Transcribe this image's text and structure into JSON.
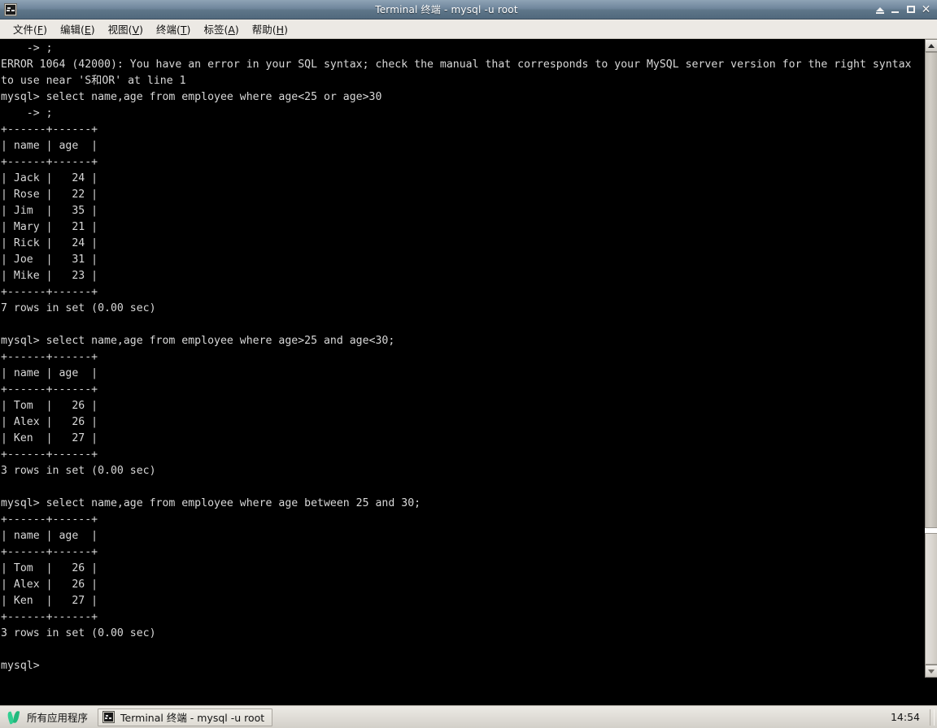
{
  "window": {
    "title": "Terminal 终端 - mysql -u root",
    "app_icon": "terminal-icon",
    "buttons": [
      {
        "name": "shade-button",
        "icon": "shade-icon"
      },
      {
        "name": "minimize-button",
        "icon": "minimize-icon"
      },
      {
        "name": "maximize-button",
        "icon": "maximize-icon"
      },
      {
        "name": "close-button",
        "icon": "close-icon",
        "label": "✕"
      }
    ]
  },
  "menubar": {
    "items": [
      {
        "label": "文件(F)",
        "text": "文件(",
        "key": "F",
        "tail": ")"
      },
      {
        "label": "编辑(E)",
        "text": "编辑(",
        "key": "E",
        "tail": ")"
      },
      {
        "label": "视图(V)",
        "text": "视图(",
        "key": "V",
        "tail": ")"
      },
      {
        "label": "终端(T)",
        "text": "终端(",
        "key": "T",
        "tail": ")"
      },
      {
        "label": "标签(A)",
        "text": "标签(",
        "key": "A",
        "tail": ")"
      },
      {
        "label": "帮助(H)",
        "text": "帮助(",
        "key": "H",
        "tail": ")"
      }
    ]
  },
  "terminal": {
    "background": "#000000",
    "foreground": "#d8d8d8",
    "cursor_color": "#18e018",
    "prompt": "mysql>",
    "content": "    -> ;\nERROR 1064 (42000): You have an error in your SQL syntax; check the manual that corresponds to your MySQL server version for the right syntax\nto use near 'S和OR' at line 1\nmysql> select name,age from employee where age<25 or age>30\n    -> ;\n+------+------+\n| name | age  |\n+------+------+\n| Jack |   24 |\n| Rose |   22 |\n| Jim  |   35 |\n| Mary |   21 |\n| Rick |   24 |\n| Joe  |   31 |\n| Mike |   23 |\n+------+------+\n7 rows in set (0.00 sec)\n\nmysql> select name,age from employee where age>25 and age<30;\n+------+------+\n| name | age  |\n+------+------+\n| Tom  |   26 |\n| Alex |   26 |\n| Ken  |   27 |\n+------+------+\n3 rows in set (0.00 sec)\n\nmysql> select name,age from employee where age between 25 and 30;\n+------+------+\n| name | age  |\n+------+------+\n| Tom  |   26 |\n| Alex |   26 |\n| Ken  |   27 |\n+------+------+\n3 rows in set (0.00 sec)\n\nmysql> ",
    "sessions": [
      {
        "command": "select name,age from employee where age<25 or age>30",
        "continuation": "    -> ;",
        "columns": [
          "name",
          "age"
        ],
        "rows": [
          [
            "Jack",
            "24"
          ],
          [
            "Rose",
            "22"
          ],
          [
            "Jim",
            "35"
          ],
          [
            "Mary",
            "21"
          ],
          [
            "Rick",
            "24"
          ],
          [
            "Joe",
            "31"
          ],
          [
            "Mike",
            "23"
          ]
        ],
        "status": "7 rows in set (0.00 sec)"
      },
      {
        "command": "select name,age from employee where age>25 and age<30;",
        "columns": [
          "name",
          "age"
        ],
        "rows": [
          [
            "Tom",
            "26"
          ],
          [
            "Alex",
            "26"
          ],
          [
            "Ken",
            "27"
          ]
        ],
        "status": "3 rows in set (0.00 sec)"
      },
      {
        "command": "select name,age from employee where age between 25 and 30;",
        "columns": [
          "name",
          "age"
        ],
        "rows": [
          [
            "Tom",
            "26"
          ],
          [
            "Alex",
            "26"
          ],
          [
            "Ken",
            "27"
          ]
        ],
        "status": "3 rows in set (0.00 sec)"
      }
    ],
    "error": "ERROR 1064 (42000): You have an error in your SQL syntax; check the manual that corresponds to your MySQL server version for the right syntax to use near 'S和OR' at line 1"
  },
  "scrollbar": {
    "up_icon": "scroll-up-arrow-icon",
    "down_icon": "scroll-down-arrow-icon"
  },
  "taskbar": {
    "apps_label": "所有应用程序",
    "apps_icon": "leaf-icon",
    "task_icon": "terminal-icon",
    "task_label": "Terminal 终端 - mysql -u root",
    "clock": "14:54"
  }
}
